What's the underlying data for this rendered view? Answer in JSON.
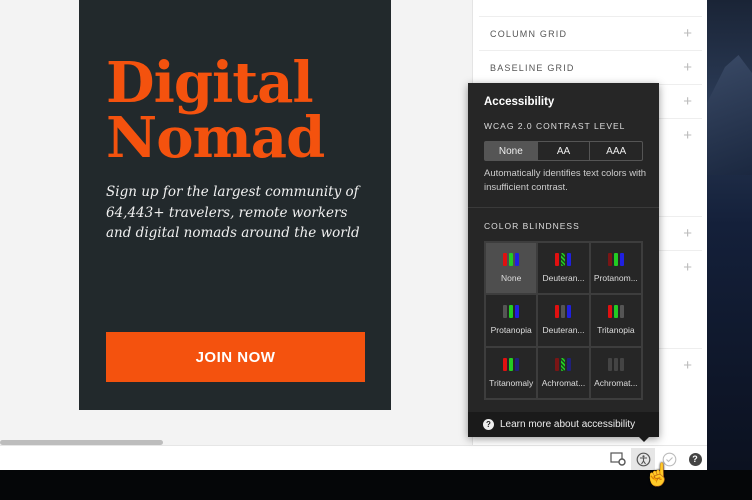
{
  "artboard": {
    "title_line1": "Digital",
    "title_line2": "Nomad",
    "subtitle": "Sign up for the largest community of 64,443+ travelers,  remote workers and digital nomads around the world",
    "cta": "JOIN NOW",
    "accent": "#f4520e"
  },
  "panel": {
    "rows": [
      {
        "label": "COLUMN GRID"
      },
      {
        "label": "BASELINE GRID"
      },
      {
        "label": ""
      },
      {
        "label": ""
      },
      {
        "label": ""
      },
      {
        "label": ""
      },
      {
        "label": ""
      }
    ],
    "plus": "+"
  },
  "popup": {
    "title": "Accessibility",
    "contrast_label": "WCAG 2.0 CONTRAST LEVEL",
    "contrast_options": [
      "None",
      "AA",
      "AAA"
    ],
    "contrast_selected": "None",
    "contrast_desc": "Automatically identifies text colors with insufficient contrast.",
    "blind_label": "COLOR BLINDNESS",
    "blind_options": [
      {
        "label": "None",
        "bars": [
          "#e01010",
          "#22cc22",
          "#2020e0"
        ]
      },
      {
        "label": "Deuteran...",
        "bars": [
          "#e01010",
          "hatch",
          "#2020e0"
        ]
      },
      {
        "label": "Protanom...",
        "bars": [
          "#7a1515",
          "#22cc22",
          "#2020e0"
        ]
      },
      {
        "label": "Protanopia",
        "bars": [
          "#555555",
          "#22cc22",
          "#2020e0"
        ]
      },
      {
        "label": "Deuteran...",
        "bars": [
          "#e01010",
          "#555555",
          "#2020e0"
        ]
      },
      {
        "label": "Tritanopia",
        "bars": [
          "#e01010",
          "#22cc22",
          "#555555"
        ]
      },
      {
        "label": "Tritanomaly",
        "bars": [
          "#e01010",
          "#22cc22",
          "#20207a"
        ]
      },
      {
        "label": "Achromat...",
        "bars": [
          "#7a1515",
          "hatch",
          "#20207a"
        ]
      },
      {
        "label": "Achromat...",
        "bars": [
          "#444444",
          "#444444",
          "#444444"
        ]
      }
    ],
    "learn_more": "Learn more about accessibility"
  },
  "toolbar": {
    "help": "?"
  }
}
